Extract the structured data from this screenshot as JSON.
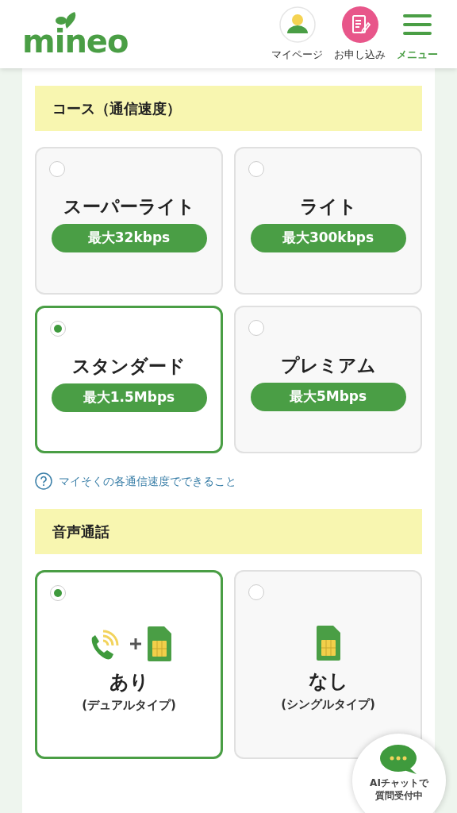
{
  "header": {
    "logo": "mineo",
    "nav": [
      {
        "kind": "mypage",
        "label": "マイページ"
      },
      {
        "kind": "apply",
        "label": "お申し込み"
      },
      {
        "kind": "menu",
        "label": "メニュー"
      }
    ]
  },
  "sections": [
    {
      "title": "コース（通信速度）",
      "kind": "speed",
      "options": [
        {
          "name": "スーパーライト",
          "badge": "最大32kbps",
          "selected": false
        },
        {
          "name": "ライト",
          "badge": "最大300kbps",
          "selected": false
        },
        {
          "name": "スタンダード",
          "badge": "最大1.5Mbps",
          "selected": true
        },
        {
          "name": "プレミアム",
          "badge": "最大5Mbps",
          "selected": false
        }
      ],
      "help_link": "マイそくの各通信速度でできること"
    },
    {
      "title": "音声通話",
      "kind": "voice",
      "options": [
        {
          "name": "あり",
          "sub": "(デュアルタイプ)",
          "kind": "dual",
          "selected": true
        },
        {
          "name": "なし",
          "sub": "(シングルタイプ)",
          "kind": "single",
          "selected": false
        }
      ]
    }
  ],
  "chat": {
    "label_lines": [
      "AIチャットで",
      "質問受付中"
    ]
  }
}
